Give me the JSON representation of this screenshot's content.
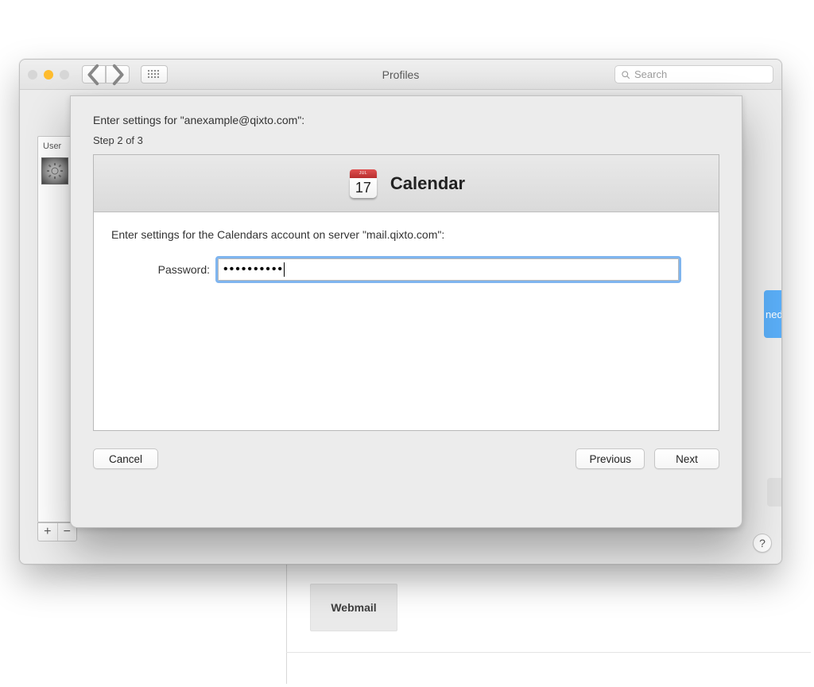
{
  "window": {
    "title": "Profiles",
    "search_placeholder": "Search",
    "sidebar_header": "User",
    "behind_badge_text": "ned"
  },
  "toolbar": {
    "add_symbol": "+",
    "remove_symbol": "−"
  },
  "sheet": {
    "header": "Enter settings for \"anexample@qixto.com\":",
    "step": "Step 2 of 3",
    "panel_title": "Calendar",
    "calendar_icon_month": "JUL",
    "calendar_icon_day": "17",
    "instruction": "Enter settings for the Calendars account on server \"mail.qixto.com\":",
    "password_label": "Password:",
    "password_dots": "••••••••••",
    "cancel": "Cancel",
    "previous": "Previous",
    "next": "Next"
  },
  "background": {
    "webmail": "Webmail"
  },
  "help_button": "?"
}
